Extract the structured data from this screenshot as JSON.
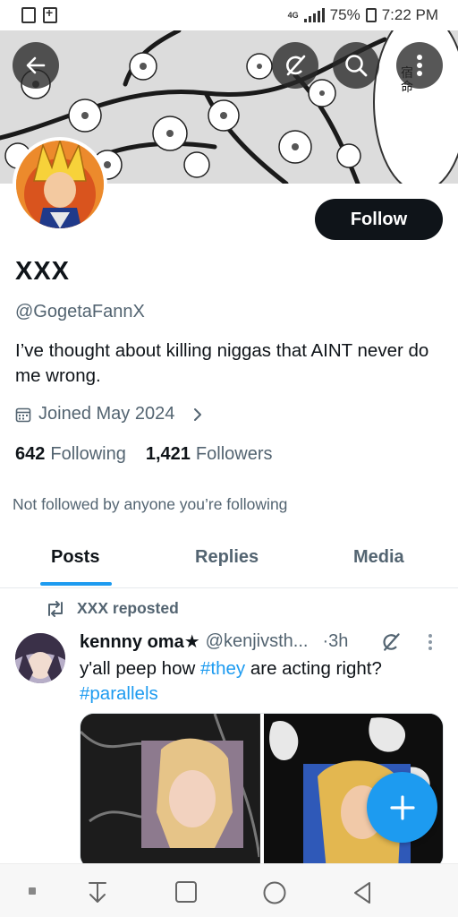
{
  "status_bar": {
    "network": "4G",
    "battery": "75%",
    "time": "7:22 PM"
  },
  "banner": {
    "overlay_text": "宿\n命"
  },
  "profile": {
    "follow_label": "Follow",
    "display_name": "XXX",
    "handle": "@GogetaFannX",
    "bio": "I’ve thought about killing niggas that AINT never do me wrong.",
    "joined": "Joined May 2024",
    "following_count": "642",
    "following_label": "Following",
    "followers_count": "1,421",
    "followers_label": "Followers",
    "followed_note": "Not followed by anyone you’re following"
  },
  "tabs": [
    {
      "label": "Posts",
      "active": true
    },
    {
      "label": "Replies",
      "active": false
    },
    {
      "label": "Media",
      "active": false
    }
  ],
  "post": {
    "repost_label": "XXX reposted",
    "author_name": "kennny oma★",
    "author_handle": "@kenjivsth...",
    "time": "·3h",
    "text_before": "y'all peep how ",
    "hashtag_1": "#they",
    "text_after": " are acting right?",
    "hashtag_2": "#parallels"
  },
  "colors": {
    "accent": "#1d9bf0",
    "text_primary": "#0f1419",
    "text_secondary": "#536471",
    "follow_button_bg": "#0f1419"
  },
  "icons": {
    "back": "arrow-left-icon",
    "grok": "grok-icon",
    "search": "search-icon",
    "more": "more-vertical-icon",
    "calendar": "calendar-icon",
    "chevron": "chevron-right-icon",
    "repost": "repost-icon",
    "compose": "plus-icon"
  }
}
